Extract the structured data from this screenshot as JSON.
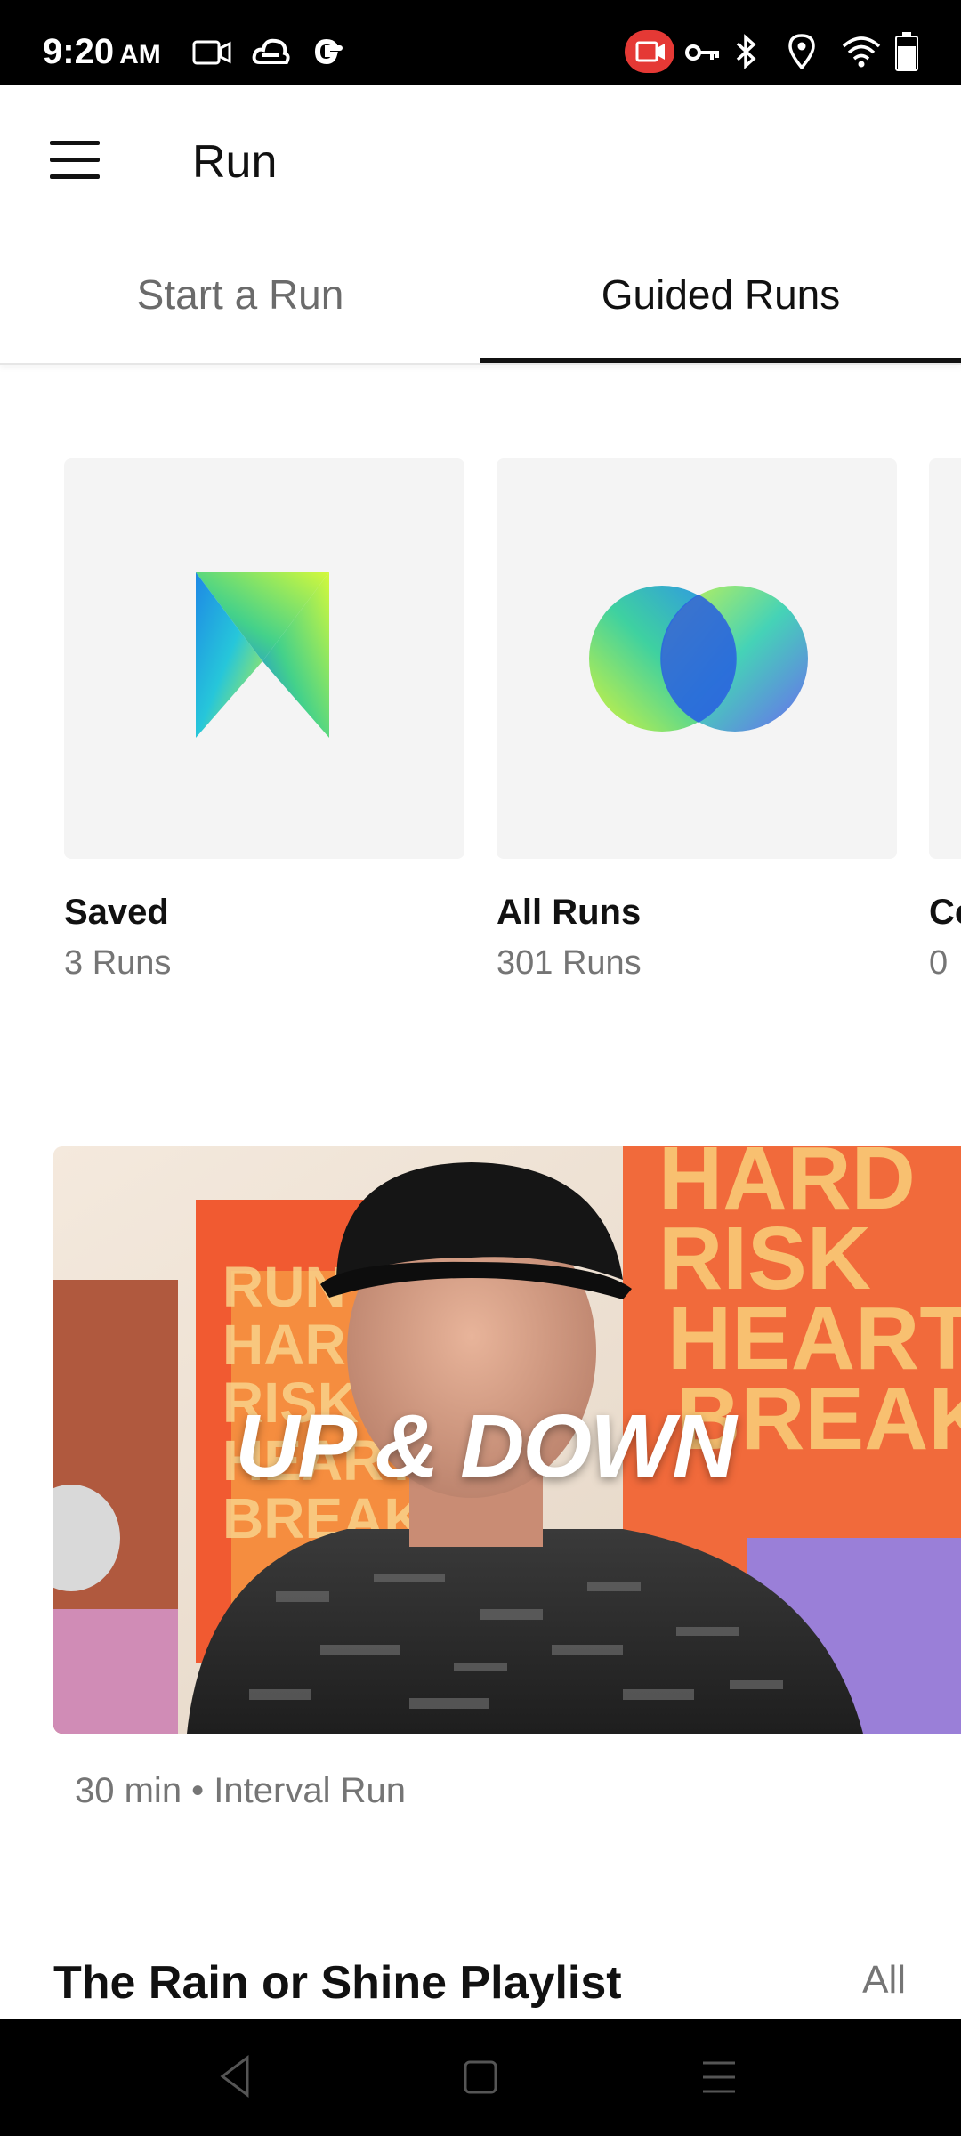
{
  "status_bar": {
    "time": "9:20",
    "ampm": "AM",
    "icons": [
      "video-icon",
      "cloud-icon",
      "google-icon",
      "screen-record-icon",
      "key-icon",
      "bluetooth-icon",
      "location-icon",
      "wifi-icon",
      "battery-icon"
    ]
  },
  "app_bar": {
    "title": "Run",
    "menu_icon": "hamburger-menu-icon"
  },
  "tabs": [
    {
      "label": "Start a Run",
      "active": false
    },
    {
      "label": "Guided Runs",
      "active": true
    }
  ],
  "collections": [
    {
      "title": "Saved",
      "subtitle": "3 Runs",
      "icon": "bookmark-logo-icon"
    },
    {
      "title": "All Runs",
      "subtitle": "301 Runs",
      "icon": "overlapping-circles-icon"
    },
    {
      "title": "Co",
      "subtitle": "0",
      "icon": ""
    }
  ],
  "featured": {
    "title": "UP & DOWN",
    "meta": "30 min • Interval Run",
    "poster_text": [
      "RUN",
      "HARD",
      "RISK",
      "HEART",
      "BREAK"
    ]
  },
  "section": {
    "title": "The Rain or Shine Playlist",
    "all_label": "All"
  },
  "nav": {
    "back_icon": "back-triangle-icon",
    "home_icon": "home-square-icon",
    "recents_icon": "recents-lines-icon"
  },
  "colors": {
    "accent": "#111111",
    "muted": "#757575",
    "card_bg": "#f4f4f4",
    "record_badge": "#e53935"
  }
}
